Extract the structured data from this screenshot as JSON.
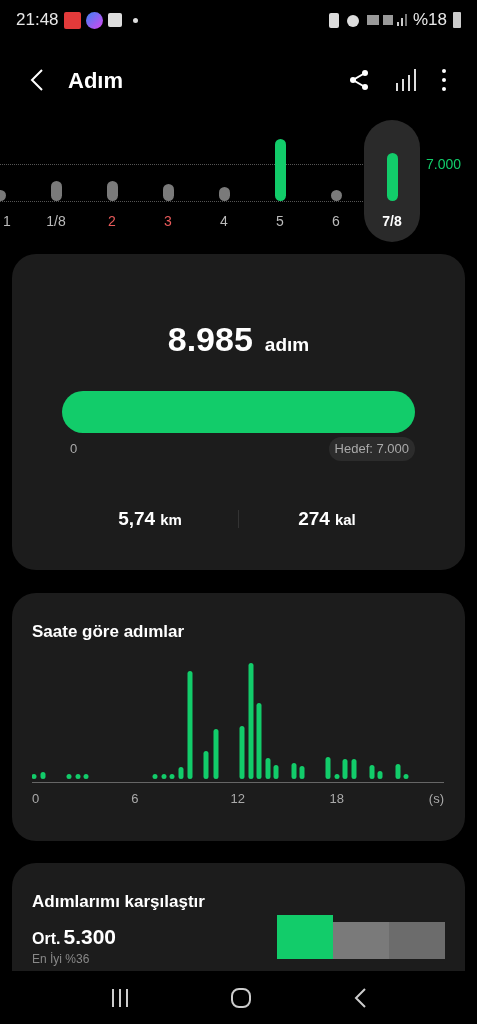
{
  "status_bar": {
    "time": "21:48",
    "battery": "%18"
  },
  "header": {
    "title": "Adım"
  },
  "week": {
    "goal_label": "7.000",
    "days": [
      {
        "label": "1",
        "selected": false,
        "color": "#bbbbbb",
        "goal_met": false
      },
      {
        "label": "1/8",
        "selected": false,
        "color": "#bbbbbb",
        "goal_met": false
      },
      {
        "label": "2",
        "selected": false,
        "color": "#e85a5a",
        "goal_met": false
      },
      {
        "label": "3",
        "selected": false,
        "color": "#e85a5a",
        "goal_met": false
      },
      {
        "label": "4",
        "selected": false,
        "color": "#bbbbbb",
        "goal_met": false
      },
      {
        "label": "5",
        "selected": false,
        "color": "#bbbbbb",
        "goal_met": true
      },
      {
        "label": "6",
        "selected": false,
        "color": "#bbbbbb",
        "goal_met": false
      },
      {
        "label": "7/8",
        "selected": true,
        "color": "#ffffff",
        "goal_met": true
      }
    ]
  },
  "summary": {
    "steps": "8.985",
    "steps_unit": "adım",
    "start_label": "0",
    "goal_label": "Hedef: 7.000",
    "distance": "5,74",
    "distance_unit": "km",
    "calories": "274",
    "calories_unit": "kal"
  },
  "hourly": {
    "title": "Saate göre adımlar",
    "ticks": [
      "0",
      "6",
      "12",
      "18",
      "(s)"
    ]
  },
  "compare": {
    "title": "Adımlarımı karşılaştır",
    "avg_label": "Ort.",
    "avg_value": "5.300",
    "best": "En İyi %36",
    "bars": [
      {
        "color": "#12cc6a"
      },
      {
        "color": "#7a7a7a"
      },
      {
        "color": "#6c6c6c"
      }
    ]
  }
}
